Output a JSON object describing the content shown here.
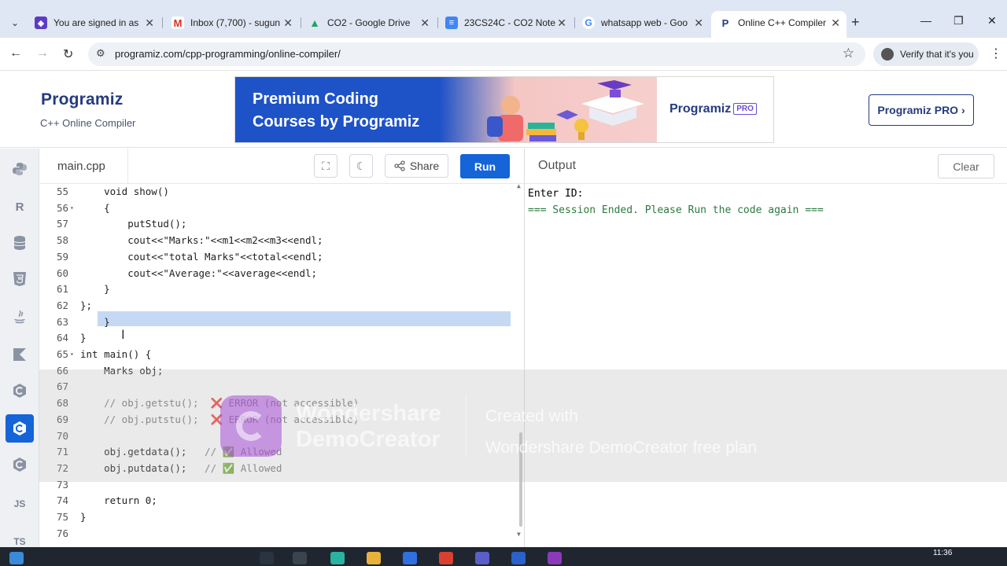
{
  "browser": {
    "tabs": [
      {
        "title": "You are signed in as ",
        "icon": "shield-icon",
        "color": "#5b3cc4"
      },
      {
        "title": "Inbox (7,700) - sugun",
        "icon": "gmail-icon",
        "color": "#d93025"
      },
      {
        "title": "CO2 - Google Drive",
        "icon": "drive-icon",
        "color": "#1fa463"
      },
      {
        "title": "23CS24C - CO2 Note",
        "icon": "docs-icon",
        "color": "#4285f4"
      },
      {
        "title": "whatsapp web - Goo",
        "icon": "google-icon",
        "color": "#4285f4"
      },
      {
        "title": "Online C++ Compiler",
        "icon": "programiz-icon",
        "color": "#253b80"
      }
    ],
    "url": "programiz.com/cpp-programming/online-compiler/",
    "verify_label": "Verify that it's you"
  },
  "site": {
    "logo": "Programiz",
    "subtitle": "C++ Online Compiler",
    "banner_line1": "Premium Coding",
    "banner_line2": "Courses by Programiz",
    "banner_logo": "Programiz",
    "banner_pro": "PRO",
    "pro_button": "Programiz PRO ›"
  },
  "sidebar": {
    "languages": [
      "python-icon",
      "r-icon",
      "sql-icon",
      "html-icon",
      "java-icon",
      "kotlin-icon",
      "c-icon",
      "cpp-icon",
      "csharp-icon",
      "js-icon",
      "ts-icon"
    ],
    "labels": [
      "",
      "R",
      "",
      "5",
      "",
      "K",
      "C",
      "C",
      "C",
      "JS",
      "TS"
    ],
    "active_index": 7
  },
  "editor": {
    "file_name": "main.cpp",
    "share_label": "Share",
    "run_label": "Run",
    "lines": [
      {
        "n": "55",
        "fold": "",
        "code": "    void show()"
      },
      {
        "n": "56",
        "fold": "▾",
        "code": "    {"
      },
      {
        "n": "57",
        "fold": "",
        "code": "        putStud();"
      },
      {
        "n": "58",
        "fold": "",
        "code": "        cout<<\"Marks:\"<<m1<<m2<<m3<<endl;"
      },
      {
        "n": "59",
        "fold": "",
        "code": "        cout<<\"total Marks\"<<total<<endl;"
      },
      {
        "n": "60",
        "fold": "",
        "code": "        cout<<\"Average:\"<<average<<endl;"
      },
      {
        "n": "61",
        "fold": "",
        "code": "    }"
      },
      {
        "n": "62",
        "fold": "",
        "code": "};"
      },
      {
        "n": "63",
        "fold": "",
        "code": "    }"
      },
      {
        "n": "64",
        "fold": "",
        "code": "}"
      },
      {
        "n": "65",
        "fold": "▾",
        "code": "int main() {"
      },
      {
        "n": "66",
        "fold": "",
        "code": "    Marks obj;"
      },
      {
        "n": "67",
        "fold": "",
        "code": ""
      },
      {
        "n": "68",
        "fold": "",
        "code": "    // obj.getstu();  ❌ ERROR (not accessible)"
      },
      {
        "n": "69",
        "fold": "",
        "code": "    // obj.putstu();  ❌ ERROR (not accessible)"
      },
      {
        "n": "70",
        "fold": "",
        "code": ""
      },
      {
        "n": "71",
        "fold": "",
        "code": "    obj.getdata();   // ✅ Allowed"
      },
      {
        "n": "72",
        "fold": "",
        "code": "    obj.putdata();   // ✅ Allowed"
      },
      {
        "n": "73",
        "fold": "",
        "code": ""
      },
      {
        "n": "74",
        "fold": "",
        "code": "    return 0;"
      },
      {
        "n": "75",
        "fold": "",
        "code": "}"
      },
      {
        "n": "76",
        "fold": "",
        "code": ""
      }
    ]
  },
  "output": {
    "title": "Output",
    "clear_label": "Clear",
    "lines": [
      "Enter ID:",
      "=== Session Ended. Please Run the code again ==="
    ]
  },
  "watermark": {
    "brand_line1": "Wondershare",
    "brand_line2": "DemoCreator",
    "created_line1": "Created with",
    "created_line2": "Wondershare DemoCreator free plan"
  },
  "taskbar": {
    "time": "11:36"
  }
}
